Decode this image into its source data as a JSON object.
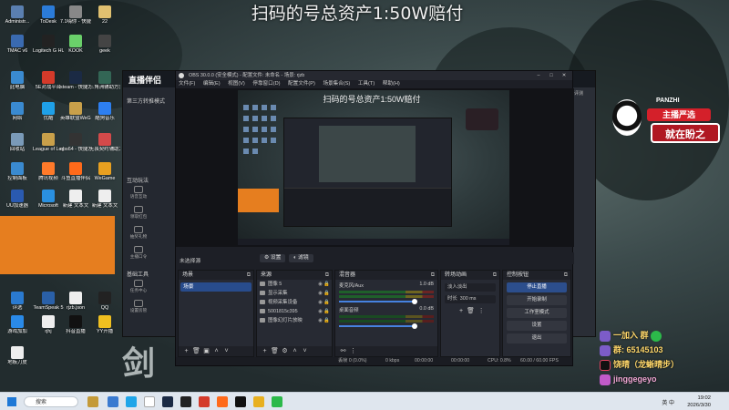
{
  "stream_title": "扫码的号总资产1:50W赔付",
  "desktop_icons": [
    {
      "label": "Administr...",
      "color": "#5a7fb0"
    },
    {
      "label": "ToDesk",
      "color": "#2b7bd8"
    },
    {
      "label": "7.1嗨你 - 快捷方式",
      "color": "#888888"
    },
    {
      "label": "22",
      "color": "#e0c070"
    },
    {
      "label": "TMAC v6",
      "color": "#3a6ab0"
    },
    {
      "label": "Logitech G HUB",
      "color": "#222222"
    },
    {
      "label": "KOOK",
      "color": "#6ad06a"
    },
    {
      "label": "geek",
      "color": "#444444"
    },
    {
      "label": "此电脑",
      "color": "#3a8ad0"
    },
    {
      "label": "5E对战平台",
      "color": "#d43a2a"
    },
    {
      "label": "steam - 快捷方式",
      "color": "#1b2a44"
    },
    {
      "label": "三角洲辅助方式",
      "color": "#336655"
    },
    {
      "label": "网络",
      "color": "#3a8ad0"
    },
    {
      "label": "优酷",
      "color": "#1fa0e8"
    },
    {
      "label": "英雄联盟WeGame",
      "color": "#c9a04a"
    },
    {
      "label": "酷狗音乐",
      "color": "#2d7ff0"
    },
    {
      "label": "回收站",
      "color": "#7a9ab8"
    },
    {
      "label": "League of Legends...",
      "color": "#c9a04a"
    },
    {
      "label": "obs64 - 快捷方式",
      "color": "#333333"
    },
    {
      "label": "无畏契约辅助方式",
      "color": "#d44a4a"
    },
    {
      "label": "控制面板",
      "color": "#3a8ad0"
    },
    {
      "label": "腾讯视频",
      "color": "#ff7a2a"
    },
    {
      "label": "斗鱼直播伴侣",
      "color": "#ff6a1a"
    },
    {
      "label": "WeGame",
      "color": "#e8a020"
    },
    {
      "label": "UU加速器",
      "color": "#2a5ab0"
    },
    {
      "label": "Microsoft",
      "color": "#2a90e0"
    },
    {
      "label": "新建 文本文",
      "color": "#eeeeee"
    },
    {
      "label": "新建 文本文",
      "color": "#eeeeee"
    },
    {
      "label": "评选",
      "color": "#2a7ad0"
    },
    {
      "label": "TeamSpeak 5",
      "color": "#2a60a8"
    },
    {
      "label": "rjzb.json",
      "color": "#eeeeee"
    },
    {
      "label": "QQ",
      "color": "#222222"
    },
    {
      "label": "游戏加加",
      "color": "#2a8ae8"
    },
    {
      "label": "rjhj",
      "color": "#eeeeee"
    },
    {
      "label": "抖音直播",
      "color": "#111111"
    },
    {
      "label": "YY开播",
      "color": "#f0c020"
    },
    {
      "label": "地板刀皮",
      "color": "#eeeeee"
    }
  ],
  "bg_app": {
    "logo": "直播伴侣",
    "sections": [
      "第三方转推模式",
      "互动玩法",
      "基础工具"
    ],
    "tools": [
      "语音互动",
      "领取红包",
      "抽奖礼物",
      "主播口令",
      "任务中心",
      "设置房管"
    ],
    "right_label": "评测"
  },
  "obs": {
    "title": "OBS 30.0.0 (安全模式) - 配置文件: 未命名 - 场景: rjzb",
    "menus": [
      "文件(F)",
      "编辑(E)",
      "视图(V)",
      "停靠窗口(D)",
      "配置文件(P)",
      "场景集合(S)",
      "工具(T)",
      "帮助(H)"
    ],
    "preview_title": "扫码的号总资产1:50W赔付",
    "current_scene": "未选择源",
    "props_btn": "设置",
    "filters_btn": "滤镜",
    "panels": {
      "scenes": {
        "title": "场景",
        "items": [
          "场景"
        ]
      },
      "sources": {
        "title": "来源",
        "items": [
          "图像 5",
          "显示采集",
          "视频采集设备",
          "5001815c395",
          "图像幻灯片放映"
        ]
      },
      "mixer": {
        "title": "混音器",
        "channels": [
          {
            "name": "麦克风/Aux",
            "db": "1.0 dB"
          },
          {
            "name": "桌面音频",
            "db": "0.0 dB"
          }
        ]
      },
      "transitions": {
        "title": "转场动画",
        "type": "淡入淡出",
        "duration_label": "时长",
        "duration": "300 ms"
      },
      "controls": {
        "title": "控制按钮",
        "buttons": [
          "停止直播",
          "开始录制",
          "工作室模式",
          "设置",
          "退出"
        ]
      }
    },
    "status": {
      "dropped": "丢帧 0 (0.0%)",
      "bitrate": "0 kbps",
      "live_time": "00:00:00",
      "rec_time": "00:00:00",
      "cpu": "CPU: 0.8%",
      "fps": "60.00 / 60.00 FPS"
    }
  },
  "overlay": {
    "panzhi_brand": "PANZHI",
    "panzhi_line1": "主播严选",
    "panzhi_line2": "就在盼之",
    "social": [
      {
        "text": "一加入 群",
        "style": "yellow"
      },
      {
        "text": "群: 65145103",
        "style": "yellow"
      },
      {
        "text": "饶晴（龙蜥晴步）",
        "style": "yellow"
      },
      {
        "text": "jinggegeyo",
        "style": "pink"
      }
    ],
    "calligraphy": "剑"
  },
  "taskbar": {
    "search_placeholder": "搜索",
    "clock_time": "19:02",
    "clock_date": "2026/3/30",
    "tray_text": "英 中"
  }
}
